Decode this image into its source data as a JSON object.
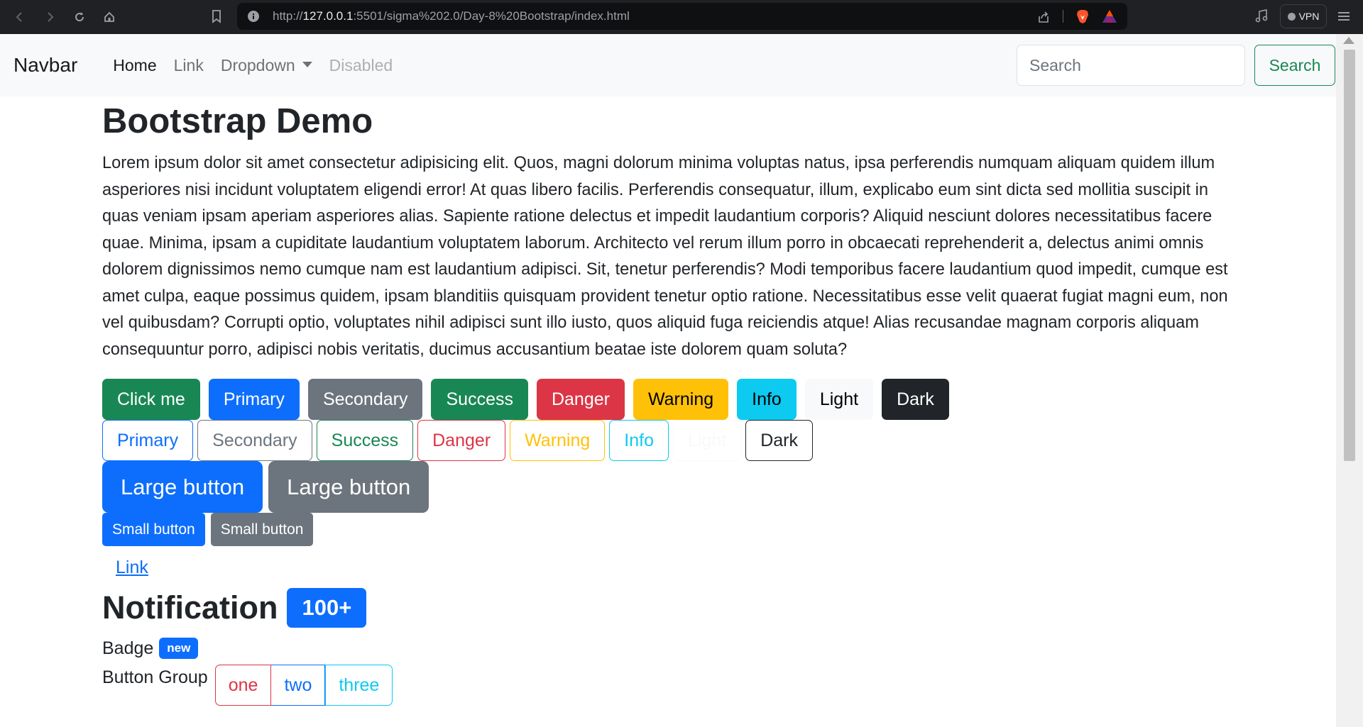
{
  "browser": {
    "url_prefix": "http://",
    "url_host": "127.0.0.1",
    "url_rest": ":5501/sigma%202.0/Day-8%20Bootstrap/index.html",
    "vpn_label": "VPN"
  },
  "navbar": {
    "brand": "Navbar",
    "links": [
      "Home",
      "Link",
      "Dropdown",
      "Disabled"
    ],
    "search_placeholder": "Search",
    "search_button": "Search"
  },
  "main": {
    "title": "Bootstrap Demo",
    "paragraph": "Lorem ipsum dolor sit amet consectetur adipisicing elit. Quos, magni dolorum minima voluptas natus, ipsa perferendis numquam aliquam quidem illum asperiores nisi incidunt voluptatem eligendi error! At quas libero facilis. Perferendis consequatur, illum, explicabo eum sint dicta sed mollitia suscipit in quas veniam ipsam aperiam asperiores alias. Sapiente ratione delectus et impedit laudantium corporis? Aliquid nesciunt dolores necessitatibus facere quae. Minima, ipsam a cupiditate laudantium voluptatem laborum. Architecto vel rerum illum porro in obcaecati reprehenderit a, delectus animi omnis dolorem dignissimos nemo cumque nam est laudantium adipisci. Sit, tenetur perferendis? Modi temporibus facere laudantium quod impedit, cumque est amet culpa, eaque possimus quidem, ipsam blanditiis quisquam provident tenetur optio ratione. Necessitatibus esse velit quaerat fugiat magni eum, non vel quibusdam? Corrupti optio, voluptates nihil adipisci sunt illo iusto, quos aliquid fuga reiciendis atque! Alias recusandae magnam corporis aliquam consequuntur porro, adipisci nobis veritatis, ducimus accusantium beatae iste dolorem quam soluta?",
    "solid_buttons": [
      "Click me",
      "Primary",
      "Secondary",
      "Success",
      "Danger",
      "Warning",
      "Info",
      "Light",
      "Dark"
    ],
    "outline_buttons": [
      "Primary",
      "Secondary",
      "Success",
      "Danger",
      "Warning",
      "Info",
      "Light",
      "Dark"
    ],
    "large_buttons": [
      "Large button",
      "Large button"
    ],
    "small_buttons": [
      "Small button",
      "Small button"
    ],
    "link_button": "Link",
    "notification_heading": "Notification",
    "notification_badge": "100+",
    "badge_label": "Badge",
    "badge_value": "new",
    "group_label": "Button Group",
    "group_buttons": [
      "one",
      "two",
      "three"
    ]
  },
  "colors": {
    "primary": "#0d6efd",
    "secondary": "#6c757d",
    "success": "#198754",
    "danger": "#dc3545",
    "warning": "#ffc107",
    "info": "#0dcaf0",
    "light": "#f8f9fa",
    "dark": "#212529"
  }
}
